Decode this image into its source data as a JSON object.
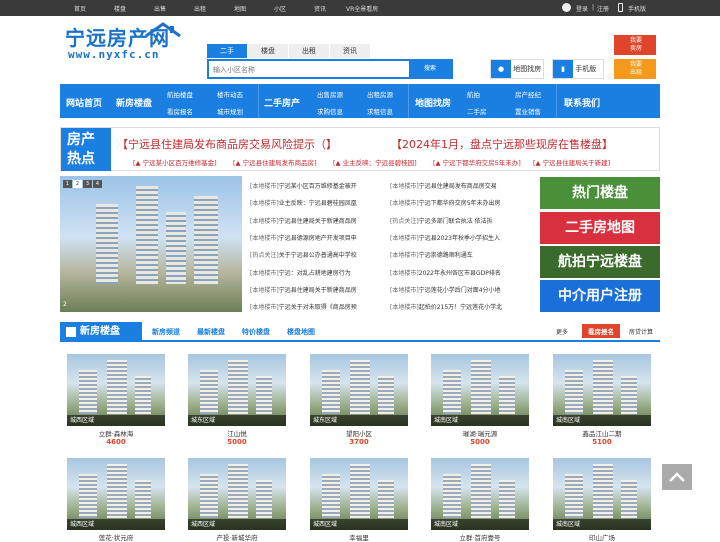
{
  "topbar": {
    "links": [
      "首页",
      "楼盘",
      "出售",
      "出租",
      "地图",
      "小区",
      "资讯",
      "VR全景看房"
    ],
    "login": "登录",
    "sep": "|",
    "register": "注册",
    "mobile": "手机版"
  },
  "logo": {
    "name": "宁远房产网",
    "url": "www.nyxfc.cn"
  },
  "search": {
    "tabs": [
      "二手",
      "楼盘",
      "出租",
      "资讯"
    ],
    "placeholder": "输入小区名称",
    "button": "搜索"
  },
  "header_buttons": {
    "map": "地图找房",
    "mobile": "手机版",
    "sell": [
      "我要",
      "卖房"
    ],
    "rent": [
      "我要",
      "出租"
    ]
  },
  "nav": {
    "home": "网站首页",
    "newhouse": "新房楼盘",
    "sub1": [
      "航拍楼盘",
      "楼市动态",
      "看房报名",
      "城市规划"
    ],
    "secondhand": "二手房产",
    "sub2": [
      "出售房源",
      "出租房源",
      "求购信息",
      "求租信息"
    ],
    "map": "地图找房",
    "sub3": [
      "航拍",
      "房产经纪",
      "二手房",
      "置业销售"
    ],
    "contact": "联系我们"
  },
  "hot": {
    "label": [
      "房产",
      "热点"
    ],
    "headline1": "【宁远县住建局发布商品房交易风险提示（】",
    "headline2": "【2024年1月，盘点宁远那些现房在售楼盘】",
    "sublinks": [
      "[▲ 宁远某小区百万维修基金]",
      "[▲ 宁远县住建局发布商品房]",
      "[▲ 业主反映：宁远县碧桂园]",
      "[▲ 宁远下都华府交房5年未办]",
      "[▲ 宁远县住建局关于新建]"
    ]
  },
  "slider": {
    "dots": [
      "1",
      "2",
      "3",
      "4"
    ],
    "index": "2"
  },
  "news_left": [
    {
      "tag": "[本地楼市]",
      "text": "宁远某小区百万维修基金被开"
    },
    {
      "tag": "[本地楼市]",
      "text": "业主反映：宁远县碧桂园凤凰"
    },
    {
      "tag": "[本地楼市]",
      "text": "宁远县住建局关于新建商品房"
    },
    {
      "tag": "[本地楼市]",
      "text": "宁远县德源房地产开发项目申"
    },
    {
      "tag": "[热点关注]",
      "text": "关于宁远县公办普通高中学校"
    },
    {
      "tag": "[本地楼市]",
      "text": "宁远：对乱占耕地建房行为"
    },
    {
      "tag": "[本地楼市]",
      "text": "宁远县住建局关于新建商品房"
    },
    {
      "tag": "[本地楼市]",
      "text": "宁远关于对未取得《商品房预"
    }
  ],
  "news_right": [
    {
      "tag": "[本地楼市]",
      "text": "宁远县住建局发布商品房交易"
    },
    {
      "tag": "[本地楼市]",
      "text": "宁远下都华府交房5年未办出房"
    },
    {
      "tag": "[热点关注]",
      "text": "宁远多部门联合执法 依法拆"
    },
    {
      "tag": "[本地楼市]",
      "text": "宁远县2023年秋季小学招生入"
    },
    {
      "tag": "[本地楼市]",
      "text": "宁远崇德路顺利通车"
    },
    {
      "tag": "[本地楼市]",
      "text": "2022年永州各区市县GDP排名"
    },
    {
      "tag": "[本地楼市]",
      "text": "宁远莲花小学后门对面4分小地"
    },
    {
      "tag": "[本地楼市]",
      "text": "起拍价215万！宁远莲花小学北"
    }
  ],
  "banners": [
    {
      "text": "热门楼盘",
      "color": "#4a8f3a"
    },
    {
      "text": "二手房地图",
      "color": "#d93040"
    },
    {
      "text": "航拍宁远楼盘",
      "color": "#3a6a2c"
    },
    {
      "text": "中介用户注册",
      "color": "#1a6fd8"
    }
  ],
  "section": {
    "title": "新房楼盘",
    "tabs": [
      "新房频道",
      "最新楼盘",
      "特价楼盘",
      "楼盘地图"
    ],
    "more": "更多",
    "signup": "看房报名",
    "calc": "房贷计算"
  },
  "listings_row1": [
    {
      "region": "城西区域",
      "name": "立群·森林海",
      "price": "4600"
    },
    {
      "region": "城东区域",
      "name": "江山悦",
      "price": "5000"
    },
    {
      "region": "城东区域",
      "name": "望阳小区",
      "price": "3700"
    },
    {
      "region": "城南区域",
      "name": "璀湖·瑞元源",
      "price": "5000"
    },
    {
      "region": "城南区域",
      "name": "鑫品江山二期",
      "price": "5100"
    }
  ],
  "listings_row2": [
    {
      "region": "城西区域",
      "name": "莲花·状元府"
    },
    {
      "region": "城西区域",
      "name": "产投·新城华府"
    },
    {
      "region": "城西区域",
      "name": "幸福里"
    },
    {
      "region": "城南区域",
      "name": "立群·首府壹号"
    },
    {
      "region": "城南区域",
      "name": "印山广场"
    }
  ]
}
